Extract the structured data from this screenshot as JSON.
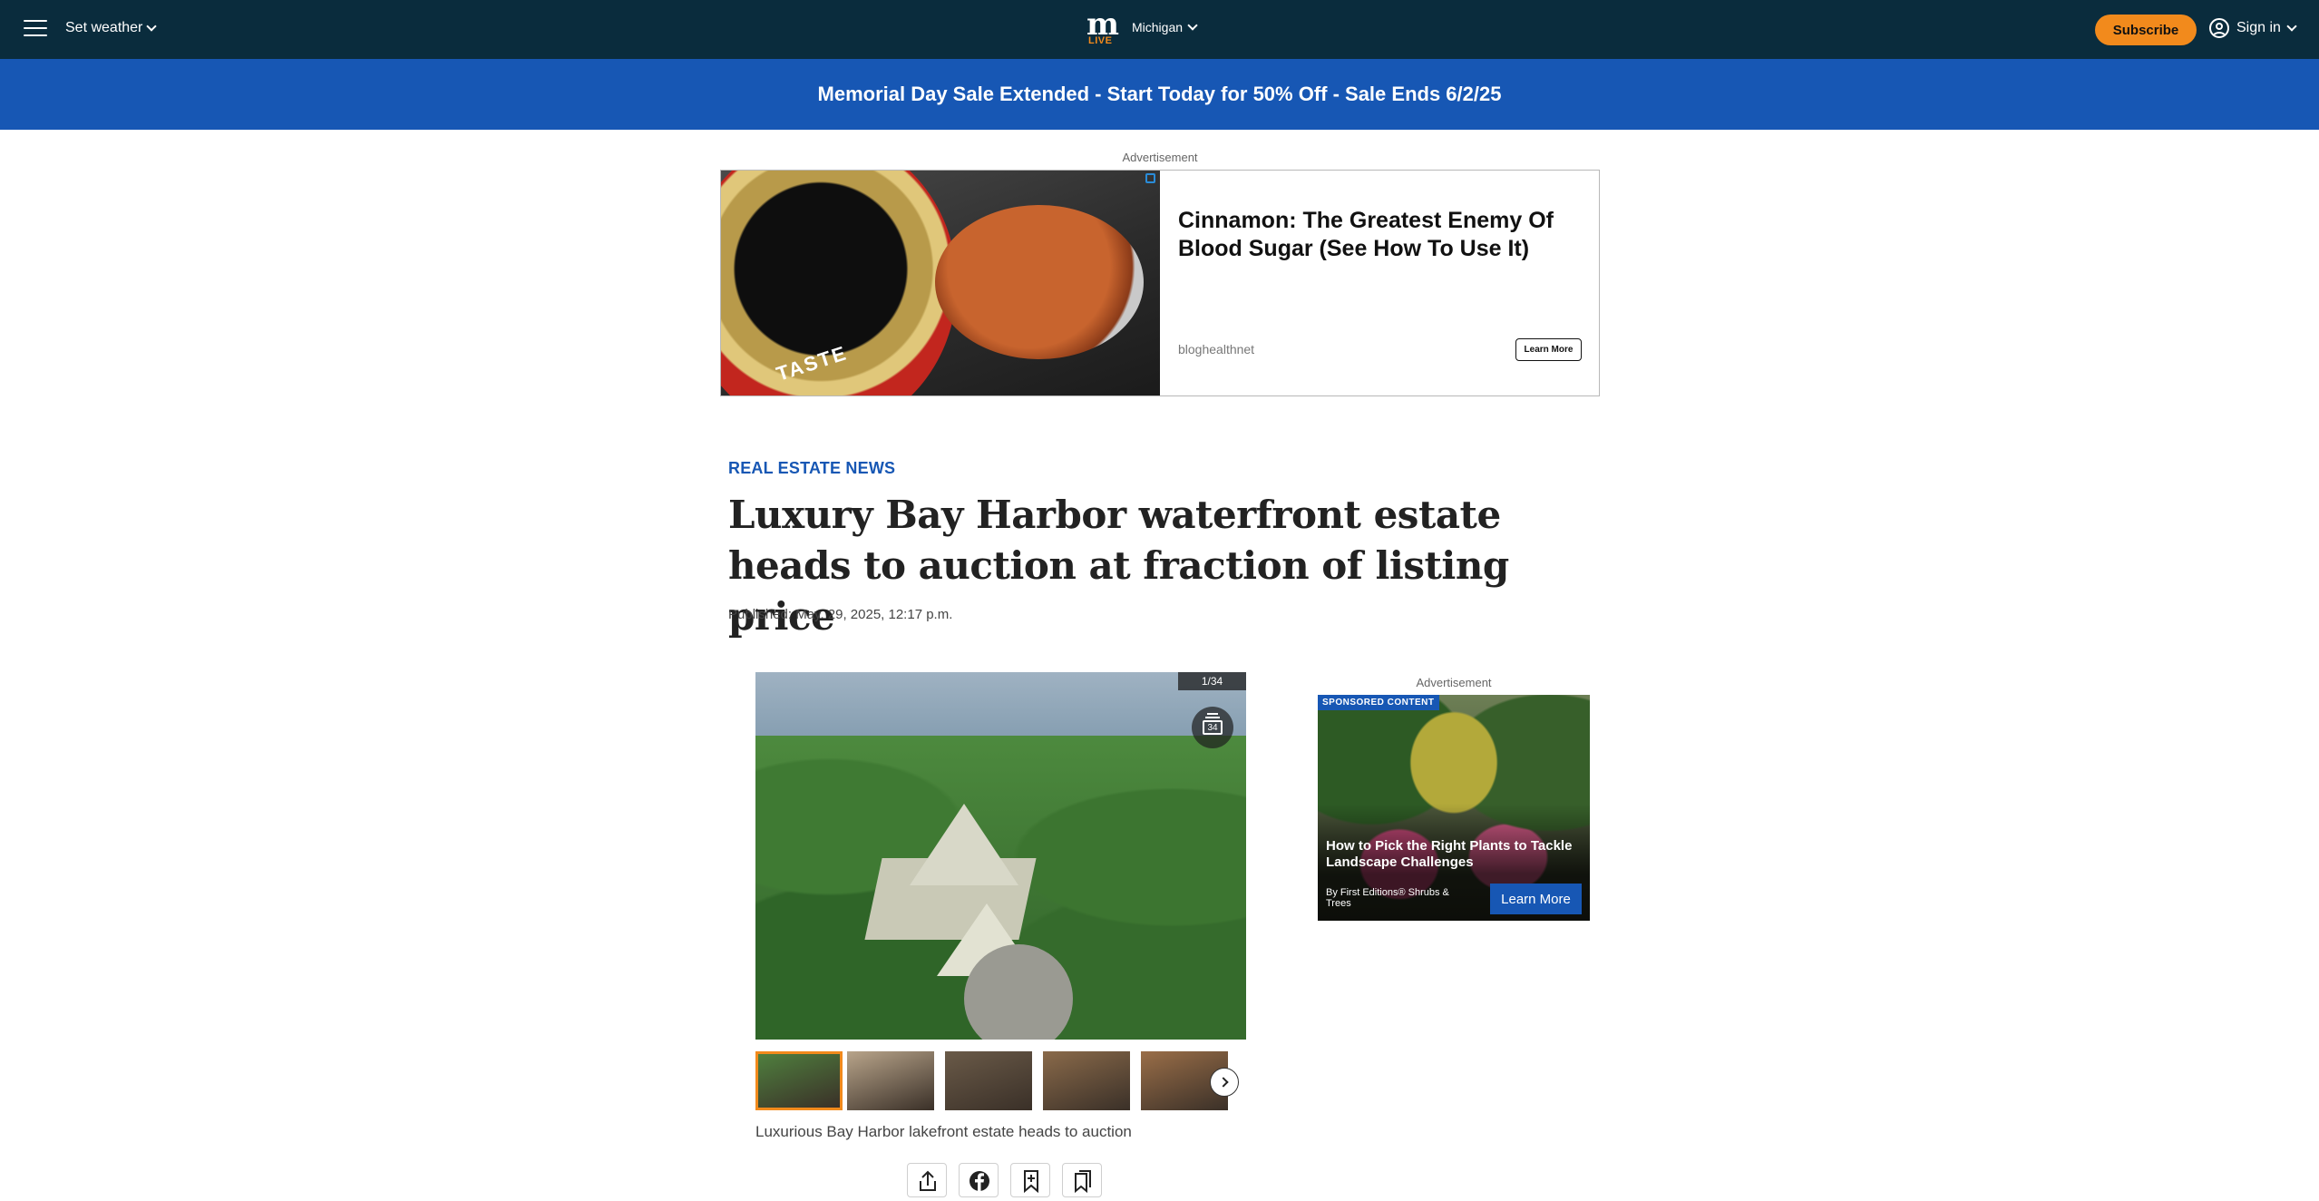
{
  "header": {
    "weather_label": "Set weather",
    "logo_letter": "m",
    "logo_sub": "LIVE",
    "region": "Michigan",
    "subscribe_label": "Subscribe",
    "signin_label": "Sign in"
  },
  "promo": {
    "text": "Memorial Day Sale Extended - Start Today for 50% Off - Sale Ends 6/2/25"
  },
  "top_ad": {
    "label": "Advertisement",
    "title": "Cinnamon: The Greatest Enemy Of Blood Sugar (See How To Use It)",
    "source": "bloghealthnet",
    "button": "Learn More",
    "image_text": "TASTE"
  },
  "article": {
    "section": "REAL ESTATE NEWS",
    "headline": "Luxury Bay Harbor waterfront estate heads to auction at fraction of listing price",
    "published": "Published: May. 29, 2025, 12:17 p.m."
  },
  "gallery": {
    "counter": "1/34",
    "count": "34",
    "caption": "Luxurious Bay Harbor lakefront estate heads to auction",
    "thumb_colors": [
      "#4f7f3e",
      "#b8a48a",
      "#6a5a48",
      "#8a6a4a",
      "#9a6e48"
    ]
  },
  "side_ad": {
    "label": "Advertisement",
    "badge": "SPONSORED CONTENT",
    "title": "How to Pick the Right Plants to Tackle Landscape Challenges",
    "byline": "By First Editions® Shrubs & Trees",
    "button": "Learn More"
  },
  "share": {
    "icons": [
      "share-icon",
      "facebook-icon",
      "bookmark-add-icon",
      "saved-list-icon"
    ]
  },
  "colors": {
    "nav_bg": "#0a2c3d",
    "brand_blue": "#1757b4",
    "accent_orange": "#f28a1c"
  }
}
